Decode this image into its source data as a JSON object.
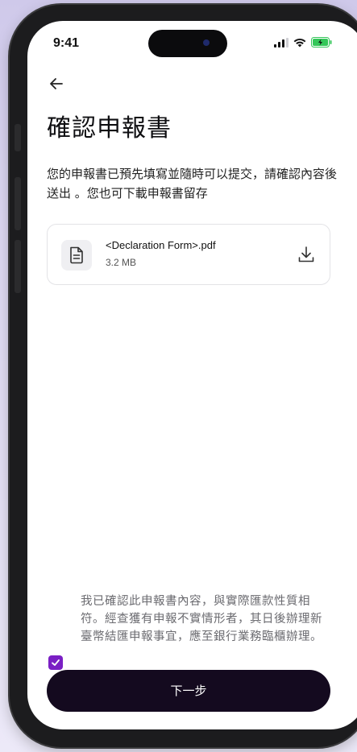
{
  "status_bar": {
    "time": "9:41"
  },
  "page": {
    "title": "確認申報書",
    "description": "您的申報書已預先填寫並隨時可以提交，請確認內容後送出 。您也可下載申報書留存"
  },
  "file": {
    "name": "<Declaration Form>.pdf",
    "size": "3.2 MB"
  },
  "consent": {
    "checked": true,
    "text": "我已確認此申報書內容，與實際匯款性質相符。經查獲有申報不實情形者，其日後辦理新臺幣結匯申報事宜，應至銀行業務臨櫃辦理。"
  },
  "actions": {
    "next_label": "下一步"
  },
  "colors": {
    "accent": "#7a1fc4",
    "button_bg": "#140a1f",
    "background": "#ddd8f2"
  },
  "icons": {
    "back": "arrow-left-icon",
    "file": "document-icon",
    "download": "download-icon",
    "check": "check-icon",
    "signal": "signal-icon",
    "wifi": "wifi-icon",
    "battery": "battery-charging-icon"
  }
}
